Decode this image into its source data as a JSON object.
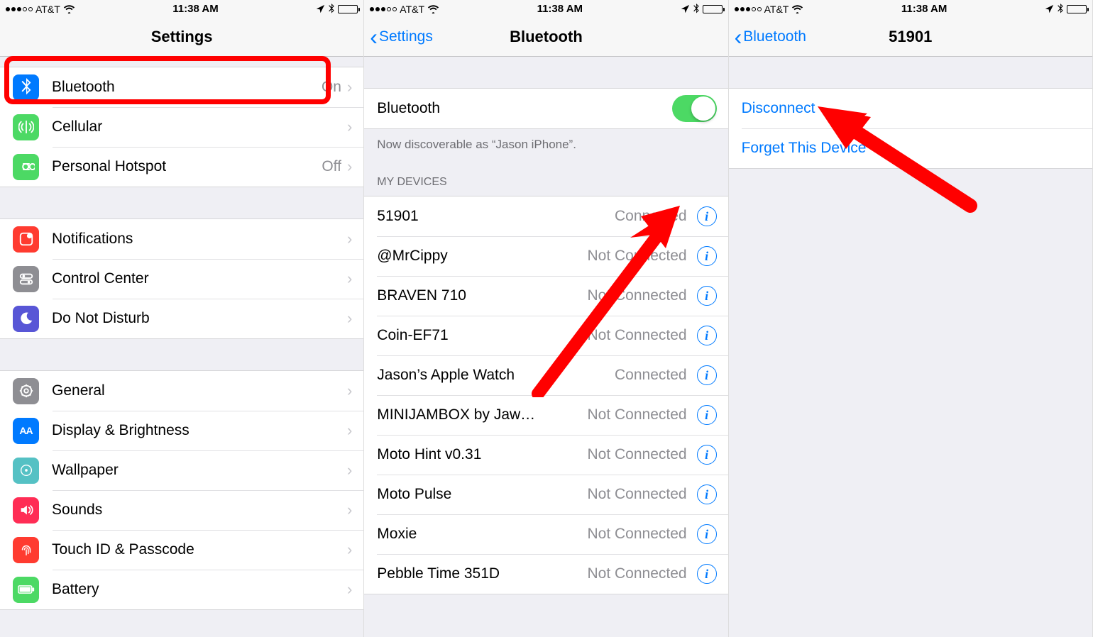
{
  "statusBar": {
    "carrier": "AT&T",
    "time": "11:38 AM"
  },
  "screen1": {
    "title": "Settings",
    "group1": [
      {
        "icon": "bluetooth",
        "iconBg": "#007aff",
        "label": "Bluetooth",
        "value": "On"
      },
      {
        "icon": "cellular",
        "iconBg": "#4cd964",
        "label": "Cellular",
        "value": ""
      },
      {
        "icon": "hotspot",
        "iconBg": "#4cd964",
        "label": "Personal Hotspot",
        "value": "Off"
      }
    ],
    "group2": [
      {
        "icon": "notifications",
        "iconBg": "#ff3b30",
        "label": "Notifications"
      },
      {
        "icon": "control-center",
        "iconBg": "#8e8e93",
        "label": "Control Center"
      },
      {
        "icon": "dnd",
        "iconBg": "#5856d6",
        "label": "Do Not Disturb"
      }
    ],
    "group3": [
      {
        "icon": "general",
        "iconBg": "#8e8e93",
        "label": "General"
      },
      {
        "icon": "display",
        "iconBg": "#007aff",
        "label": "Display & Brightness"
      },
      {
        "icon": "wallpaper",
        "iconBg": "#55c1c4",
        "label": "Wallpaper"
      },
      {
        "icon": "sounds",
        "iconBg": "#ff2d55",
        "label": "Sounds"
      },
      {
        "icon": "touchid",
        "iconBg": "#ff3b30",
        "label": "Touch ID & Passcode"
      },
      {
        "icon": "battery",
        "iconBg": "#4cd964",
        "label": "Battery"
      }
    ]
  },
  "screen2": {
    "backLabel": "Settings",
    "title": "Bluetooth",
    "toggleLabel": "Bluetooth",
    "discoverable": "Now discoverable as “Jason iPhone”.",
    "devicesHeader": "MY DEVICES",
    "devices": [
      {
        "name": "51901",
        "status": "Connected"
      },
      {
        "name": "@MrCippy",
        "status": "Not Connected"
      },
      {
        "name": "BRAVEN 710",
        "status": "Not Connected"
      },
      {
        "name": "Coin-EF71",
        "status": "Not Connected"
      },
      {
        "name": "Jason’s Apple Watch",
        "status": "Connected"
      },
      {
        "name": "MINIJAMBOX by Jaw…",
        "status": "Not Connected"
      },
      {
        "name": "Moto Hint v0.31",
        "status": "Not Connected"
      },
      {
        "name": "Moto Pulse",
        "status": "Not Connected"
      },
      {
        "name": "Moxie",
        "status": "Not Connected"
      },
      {
        "name": "Pebble Time 351D",
        "status": "Not Connected"
      }
    ]
  },
  "screen3": {
    "backLabel": "Bluetooth",
    "title": "51901",
    "actions": {
      "disconnect": "Disconnect",
      "forget": "Forget This Device"
    }
  }
}
